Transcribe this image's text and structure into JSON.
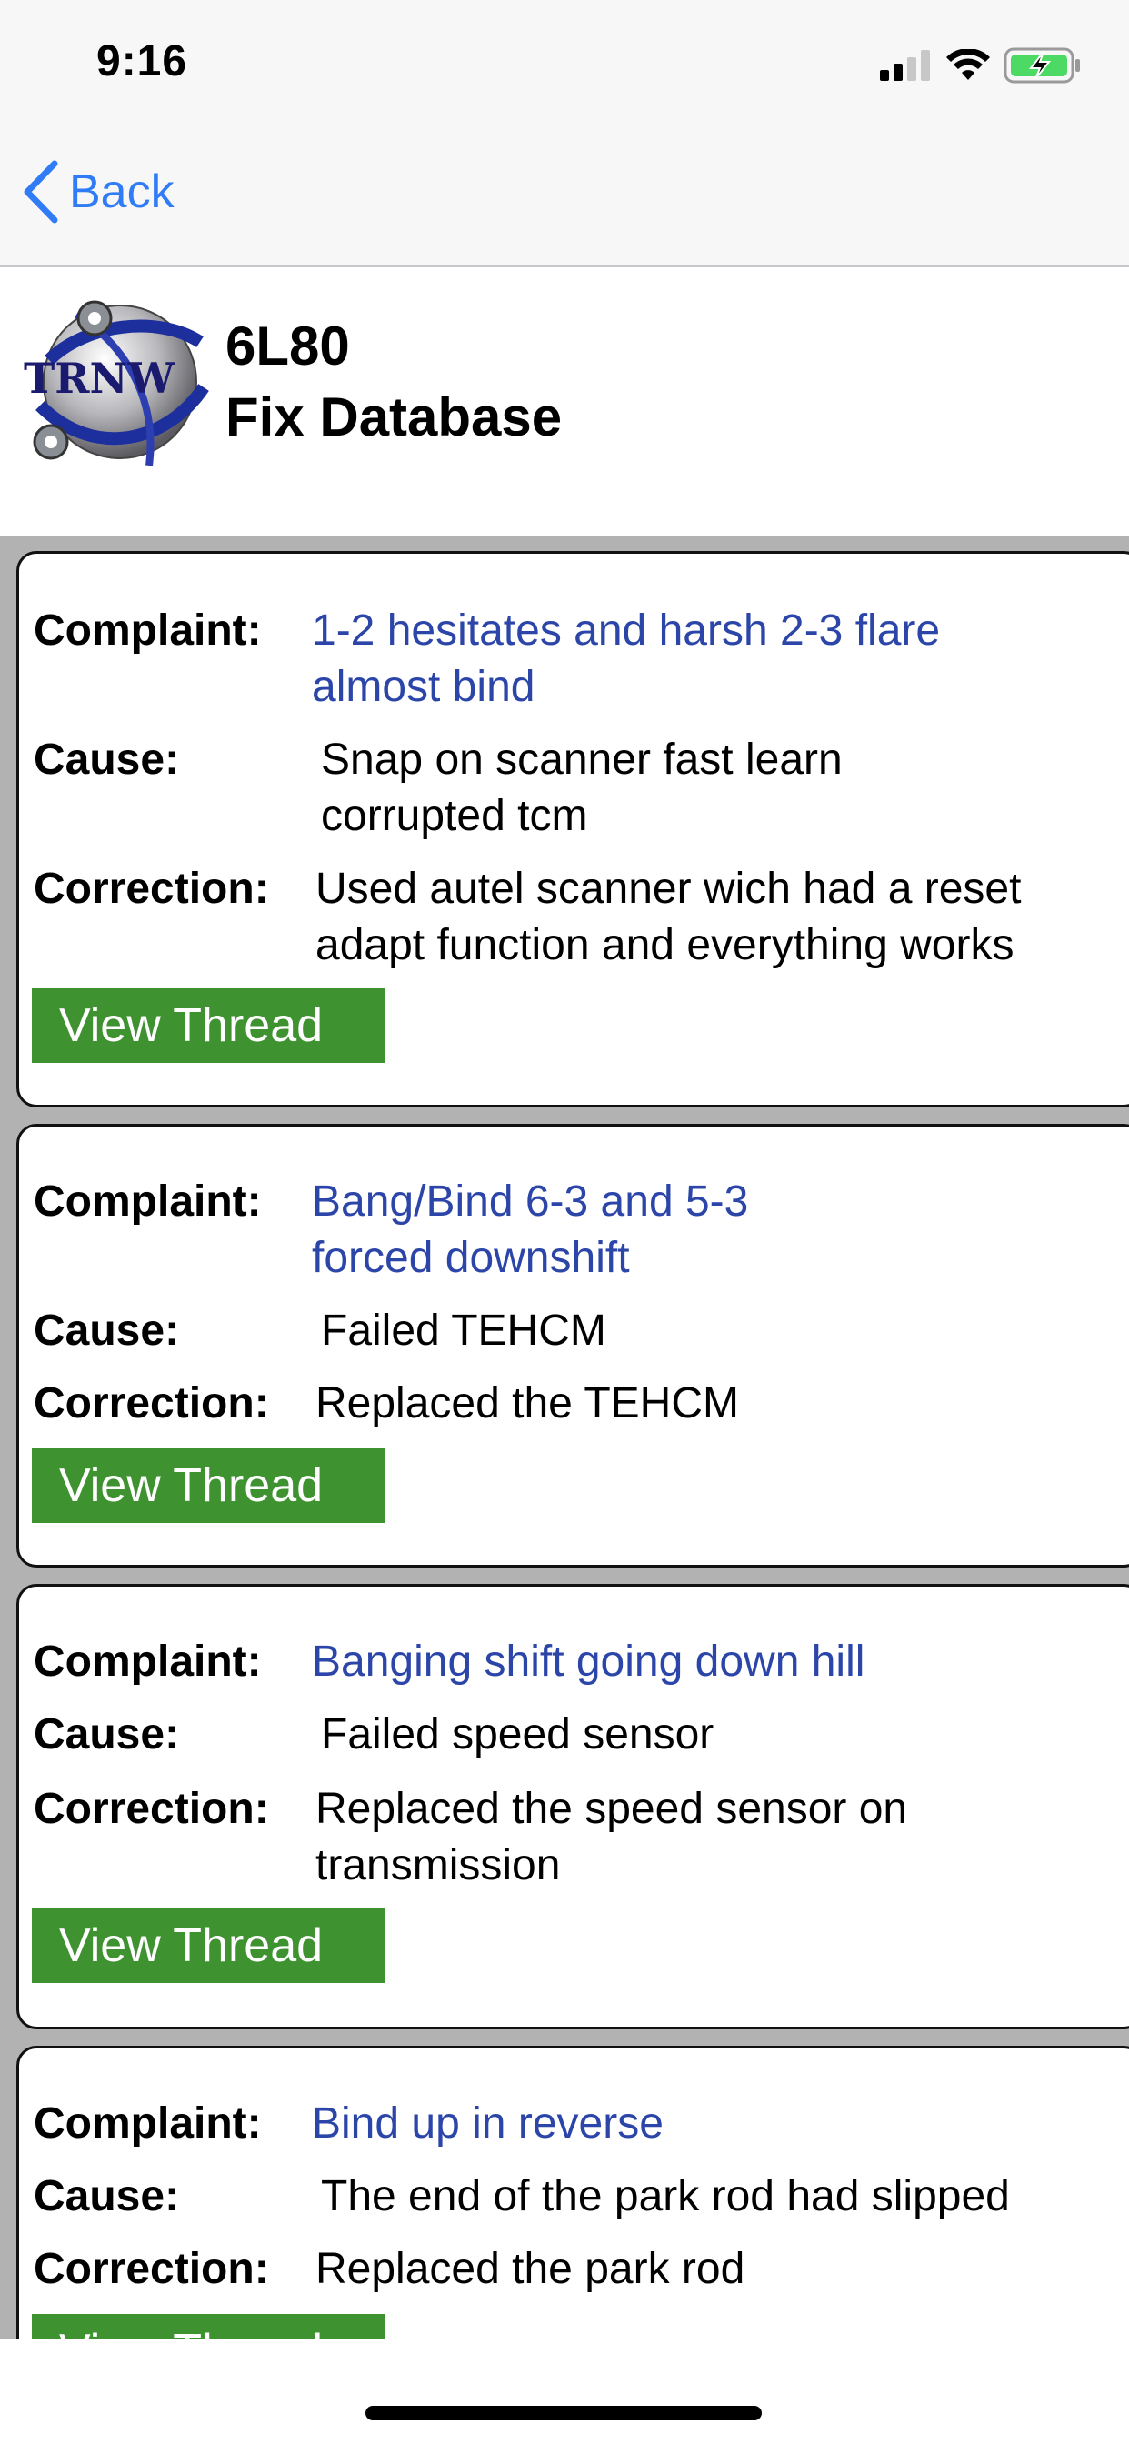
{
  "status_bar": {
    "time": "9:16"
  },
  "nav": {
    "back_label": "Back"
  },
  "header": {
    "logo_text": "TRNW",
    "title_line1": "6L80",
    "title_line2": "Fix Database"
  },
  "labels": {
    "complaint": "Complaint:",
    "cause": "Cause:",
    "correction": "Correction:",
    "view_thread": "View Thread"
  },
  "entries": [
    {
      "complaint": [
        "1-2 hesitates and harsh 2-3 flare",
        "almost bind"
      ],
      "cause": [
        "Snap on scanner fast learn",
        "corrupted tcm"
      ],
      "correction": [
        "Used autel scanner wich had a reset",
        "adapt function and everything works"
      ]
    },
    {
      "complaint": [
        "Bang/Bind 6-3 and 5-3",
        "forced downshift"
      ],
      "cause": [
        "Failed TEHCM"
      ],
      "correction": [
        "Replaced the TEHCM"
      ]
    },
    {
      "complaint": [
        "Banging shift going down hill"
      ],
      "cause": [
        "Failed speed sensor"
      ],
      "correction": [
        "Replaced the speed sensor on",
        "transmission"
      ]
    },
    {
      "complaint": [
        "Bind up in reverse"
      ],
      "cause": [
        "The end of the park rod had slipped"
      ],
      "correction": [
        "Replaced the park rod"
      ]
    }
  ],
  "colors": {
    "link_blue": "#2f7cf6",
    "complaint_blue": "#2c45a8",
    "button_green": "#3f9230",
    "list_gray": "#b2b2b2"
  },
  "icons": [
    "signal-icon",
    "wifi-icon",
    "battery-charging-icon",
    "chevron-left-icon"
  ]
}
